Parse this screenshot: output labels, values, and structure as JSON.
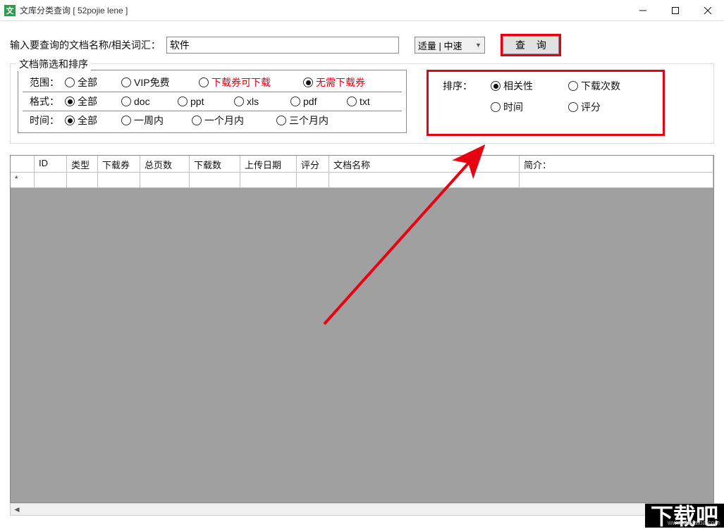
{
  "window": {
    "title": "文库分类查询 [ 52pojie lene ]"
  },
  "search": {
    "label": "输入要查询的文档名称/相关词汇：",
    "value": "软件",
    "mode_selected": "适量 | 中速",
    "query_btn": "查 询"
  },
  "filters": {
    "group_title": "文档筛选和排序",
    "scope": {
      "label": "范围：",
      "options": [
        "全部",
        "VIP免费",
        "下载券可下载",
        "无需下载券"
      ],
      "selected": "无需下载券"
    },
    "format": {
      "label": "格式：",
      "options": [
        "全部",
        "doc",
        "ppt",
        "xls",
        "pdf",
        "txt"
      ],
      "selected": "全部"
    },
    "time": {
      "label": "时间：",
      "options": [
        "全部",
        "一周内",
        "一个月内",
        "三个月内"
      ],
      "selected": "全部"
    }
  },
  "sort": {
    "label": "排序：",
    "options_row1": [
      "相关性",
      "下载次数"
    ],
    "options_row2": [
      "时间",
      "评分"
    ],
    "selected": "相关性"
  },
  "grid": {
    "columns": [
      "",
      "ID",
      "类型",
      "下载券",
      "总页数",
      "下载数",
      "上传日期",
      "评分",
      "文档名称",
      "简介："
    ],
    "row_marker": "*"
  },
  "watermark": {
    "text": "下载吧",
    "url": "www.xiazaiba.com"
  }
}
